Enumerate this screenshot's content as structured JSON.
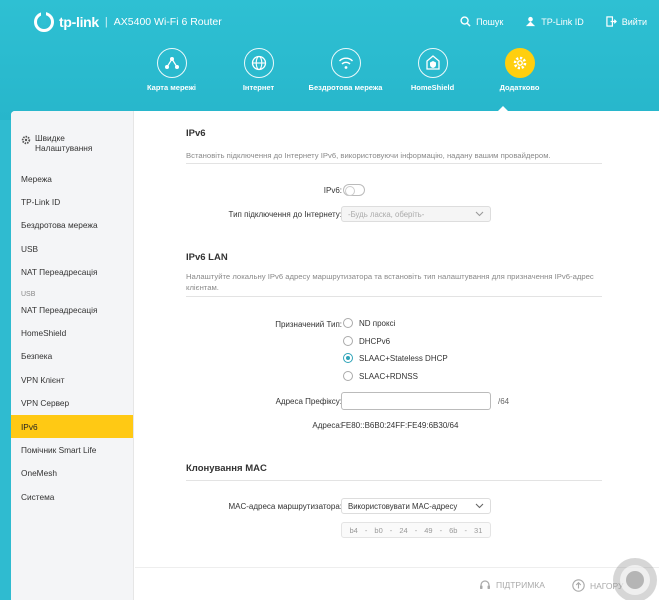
{
  "header": {
    "brand": "tp-link",
    "model": "AX5400 Wi-Fi 6 Router",
    "actions": [
      {
        "label": "Пошук",
        "icon": "search-icon"
      },
      {
        "label": "TP-Link ID",
        "icon": "user-id-icon"
      },
      {
        "label": "Вийти",
        "icon": "logout-icon"
      }
    ]
  },
  "nav": [
    {
      "label": "Карта мережі",
      "icon": "network-map-icon"
    },
    {
      "label": "Інтернет",
      "icon": "globe-icon"
    },
    {
      "label": "Бездротова мережа",
      "icon": "wifi-icon"
    },
    {
      "label": "HomeShield",
      "icon": "homeshield-icon"
    },
    {
      "label": "Додатково",
      "icon": "advanced-gear-icon",
      "active": true
    }
  ],
  "sidebar": {
    "quick": "Швидке Налаштування",
    "items": [
      "Мережа",
      "TP-Link ID",
      "Бездротова мережа",
      "USB",
      "NAT Переадресація",
      "USB",
      "NAT Переадресація",
      "HomeShield",
      "Безпека",
      "VPN Клієнт",
      "VPN Сервер",
      "IPv6",
      "Помічник Smart Life",
      "OneMesh",
      "Система"
    ],
    "active": "IPv6"
  },
  "ipv6": {
    "title": "IPv6",
    "desc": "Встановіть підключення до Інтернету IPv6, використовуючи інформацію, надану вашим провайдером.",
    "toggle_label": "IPv6:",
    "conn_label": "Тип підключення до Інтернету:",
    "conn_placeholder": "-Будь ласка, оберіть-"
  },
  "lan": {
    "title": "IPv6 LAN",
    "desc": "Налаштуйте локальну IPv6 адресу маршрутизатора та встановіть тип налаштування для призначення IPv6-адрес клієнтам.",
    "assign_label": "Призначений Тип:",
    "options": [
      "ND проксі",
      "DHCPv6",
      "SLAAC+Stateless DHCP",
      "SLAAC+RDNSS"
    ],
    "selected": "SLAAC+Stateless DHCP",
    "prefix_label": "Адреса Префіксу:",
    "prefix_value": "",
    "prefix_suffix": "/64",
    "address_label": "Адреса:",
    "address_value": "FE80::B6B0:24FF:FE49:6B30/64"
  },
  "mac": {
    "title": "Клонування MAC",
    "label": "MAC-адреса маршрутизатора:",
    "select_value": "Використовувати MAC-адресу",
    "octets": [
      "b4",
      "b0",
      "24",
      "49",
      "6b",
      "31"
    ]
  },
  "footer": {
    "support": "ПІДТРИМКА",
    "top": "НАГОРУ"
  },
  "colors": {
    "header_bg": "#2ec0d3",
    "accent_yellow": "#ffc914",
    "radio_accent": "#2ea3b8"
  }
}
